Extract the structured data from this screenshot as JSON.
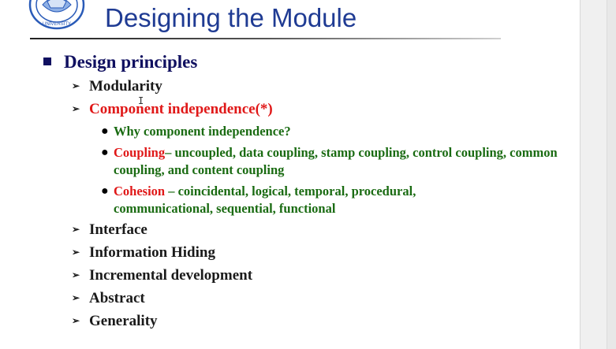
{
  "slide": {
    "logo_text": "UNIVERSITY",
    "title": "Designing the Module",
    "heading": "Design principles",
    "items": [
      {
        "label": "Modularity"
      },
      {
        "label": "Component independence(*)"
      },
      {
        "label": "Interface"
      },
      {
        "label": "Information Hiding"
      },
      {
        "label": "Incremental development"
      },
      {
        "label": "Abstract"
      },
      {
        "label": "Generality"
      }
    ],
    "subitems": [
      {
        "text": "Why component independence?"
      },
      {
        "term": "Coupling",
        "text": "– uncoupled, data coupling, stamp coupling, control coupling, common coupling, and content coupling"
      },
      {
        "term": "Cohesion",
        "text": " – coincidental, logical, temporal, procedural, communicational, sequential, functional"
      }
    ]
  },
  "colors": {
    "title": "#1f3b93",
    "heading": "#101060",
    "accent_red": "#e01818",
    "sub_green": "#1a6b12"
  },
  "icons": {
    "level1_bullet": "square-bullet",
    "level2_bullet": "arrow-bullet",
    "level3_bullet": "dot-bullet"
  }
}
